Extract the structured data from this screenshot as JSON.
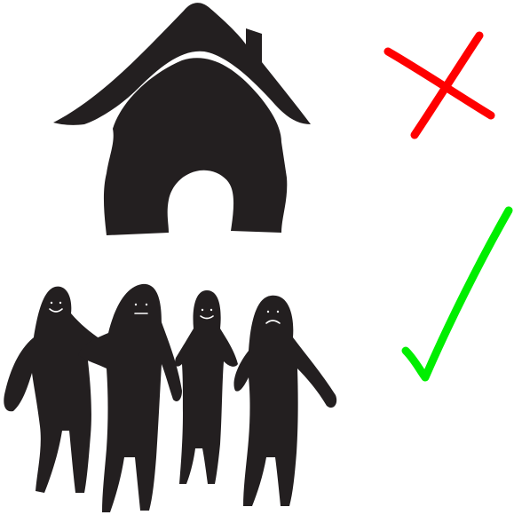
{
  "illustration": {
    "house": {
      "icon": "house-icon",
      "color": "#231f20"
    },
    "group": {
      "icon": "group-of-people-icon",
      "color": "#231f20",
      "face_color": "#ffffff",
      "person_count": 4,
      "persons": [
        {
          "icon": "person-icon",
          "expression": "smile"
        },
        {
          "icon": "person-icon",
          "expression": "neutral"
        },
        {
          "icon": "person-icon",
          "expression": "smile"
        },
        {
          "icon": "person-icon",
          "expression": "frown"
        }
      ]
    },
    "verdicts": [
      {
        "row": "house",
        "icon": "cross-icon",
        "meaning": "wrong",
        "color": "#ff0000"
      },
      {
        "row": "group",
        "icon": "checkmark-icon",
        "meaning": "correct",
        "color": "#00ee00"
      }
    ]
  }
}
